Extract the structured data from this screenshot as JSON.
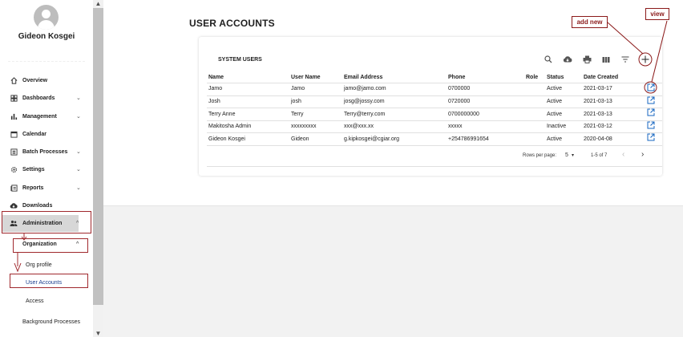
{
  "sidebar": {
    "user_name": "Gideon Kosgei",
    "items": [
      {
        "label": "Overview",
        "icon": "home-icon",
        "chevron": ""
      },
      {
        "label": "Dashboards",
        "icon": "dashboard-icon",
        "chevron": "⌄"
      },
      {
        "label": "Management",
        "icon": "bar-chart-icon",
        "chevron": "⌄"
      },
      {
        "label": "Calendar",
        "icon": "calendar-icon",
        "chevron": ""
      },
      {
        "label": "Batch Processes",
        "icon": "list-icon",
        "chevron": "⌄"
      },
      {
        "label": "Settings",
        "icon": "gear-icon",
        "chevron": "⌄"
      },
      {
        "label": "Reports",
        "icon": "report-icon",
        "chevron": "⌄"
      },
      {
        "label": "Downloads",
        "icon": "cloud-download-icon",
        "chevron": ""
      },
      {
        "label": "Administration",
        "icon": "people-icon",
        "chevron": "^"
      }
    ],
    "sub_organization": {
      "label": "Organization",
      "chevron": "^"
    },
    "sub_items": [
      "Org profile",
      "User Accounts",
      "Access",
      "Background Processes"
    ]
  },
  "main": {
    "title": "USER ACCOUNTS",
    "card_title": "SYSTEM USERS",
    "columns": [
      "Name",
      "User Name",
      "Email Address",
      "Phone",
      "Role",
      "Status",
      "Date Created"
    ],
    "rows": [
      {
        "name": "Jamo",
        "username": "Jamo",
        "email": "jamo@jamo.com",
        "phone": "0700000",
        "role": "",
        "status": "Active",
        "date": "2021-03-17"
      },
      {
        "name": "Josh",
        "username": "josh",
        "email": "josg@jossy.com",
        "phone": "0720000",
        "role": "",
        "status": "Active",
        "date": "2021-03-13"
      },
      {
        "name": "Terry Anne",
        "username": "Terry",
        "email": "Terry@terry.com",
        "phone": "0700000000",
        "role": "",
        "status": "Active",
        "date": "2021-03-13"
      },
      {
        "name": "Makitosha Admin",
        "username": "xxxxxxxxx",
        "email": "xxx@xxx.xx",
        "phone": "xxxxx",
        "role": "",
        "status": "Inactive",
        "date": "2021-03-12"
      },
      {
        "name": "Gideon Kosgei",
        "username": "Gideon",
        "email": "g.kipkosgei@cgiar.org",
        "phone": "+254786991654",
        "role": "",
        "status": "Active",
        "date": "2020-04-08"
      }
    ],
    "footer": {
      "rows_per_page_label": "Rows per page:",
      "rows_per_page_value": "5",
      "range": "1-5 of 7"
    }
  },
  "annotations": {
    "add_new": "add new",
    "view": "view"
  },
  "colors": {
    "annotation": "#a0282d",
    "accent": "#1565c0"
  }
}
